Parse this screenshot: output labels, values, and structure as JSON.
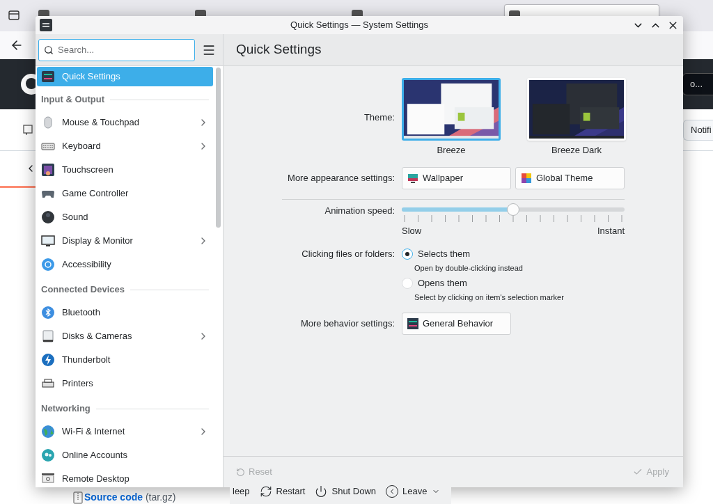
{
  "browser": {
    "tabs": [
      {
        "selected": false
      },
      {
        "selected": false
      },
      {
        "selected": false
      },
      {
        "selected": true
      }
    ],
    "header_field_text": "o...",
    "notifications_button": "Notifi",
    "download_link": "Source code",
    "download_suffix": "(tar.gz)"
  },
  "window": {
    "title": "Quick Settings — System Settings"
  },
  "search": {
    "placeholder": "Search..."
  },
  "page_title": "Quick Settings",
  "sidebar": {
    "items": [
      {
        "kind": "item",
        "label": "Quick Settings",
        "selected": true,
        "submenu": false
      },
      {
        "kind": "header",
        "label": "Input & Output"
      },
      {
        "kind": "item",
        "label": "Mouse & Touchpad",
        "selected": false,
        "submenu": true
      },
      {
        "kind": "item",
        "label": "Keyboard",
        "selected": false,
        "submenu": true
      },
      {
        "kind": "item",
        "label": "Touchscreen",
        "selected": false,
        "submenu": false
      },
      {
        "kind": "item",
        "label": "Game Controller",
        "selected": false,
        "submenu": false
      },
      {
        "kind": "item",
        "label": "Sound",
        "selected": false,
        "submenu": false
      },
      {
        "kind": "item",
        "label": "Display & Monitor",
        "selected": false,
        "submenu": true
      },
      {
        "kind": "item",
        "label": "Accessibility",
        "selected": false,
        "submenu": false
      },
      {
        "kind": "header",
        "label": "Connected Devices"
      },
      {
        "kind": "item",
        "label": "Bluetooth",
        "selected": false,
        "submenu": false
      },
      {
        "kind": "item",
        "label": "Disks & Cameras",
        "selected": false,
        "submenu": true
      },
      {
        "kind": "item",
        "label": "Thunderbolt",
        "selected": false,
        "submenu": false
      },
      {
        "kind": "item",
        "label": "Printers",
        "selected": false,
        "submenu": false
      },
      {
        "kind": "header",
        "label": "Networking"
      },
      {
        "kind": "item",
        "label": "Wi-Fi & Internet",
        "selected": false,
        "submenu": true
      },
      {
        "kind": "item",
        "label": "Online Accounts",
        "selected": false,
        "submenu": false
      },
      {
        "kind": "item",
        "label": "Remote Desktop",
        "selected": false,
        "submenu": false
      }
    ]
  },
  "theme": {
    "label": "Theme:",
    "options": [
      {
        "name": "Breeze",
        "selected": true
      },
      {
        "name": "Breeze Dark",
        "selected": false
      }
    ]
  },
  "appearance": {
    "label": "More appearance settings:",
    "buttons": [
      "Wallpaper",
      "Global Theme"
    ]
  },
  "animation": {
    "label": "Animation speed:",
    "level": 0.5,
    "min_label": "Slow",
    "max_label": "Instant"
  },
  "clicking": {
    "label": "Clicking files or folders:",
    "options": [
      {
        "label": "Selects them",
        "hint": "Open by double-clicking instead",
        "selected": true
      },
      {
        "label": "Opens them",
        "hint": "Select by clicking on item's selection marker",
        "selected": false
      }
    ]
  },
  "behavior": {
    "label": "More behavior settings:",
    "button": "General Behavior"
  },
  "footer": {
    "reset": {
      "label": "Reset",
      "disabled": true
    },
    "apply": {
      "label": "Apply",
      "disabled": true
    }
  },
  "session_bar": {
    "items": [
      {
        "kind": "sleep",
        "label": "leep"
      },
      {
        "kind": "restart",
        "label": "Restart"
      },
      {
        "kind": "shutdown",
        "label": "Shut Down"
      },
      {
        "kind": "leave",
        "label": "Leave"
      }
    ]
  }
}
